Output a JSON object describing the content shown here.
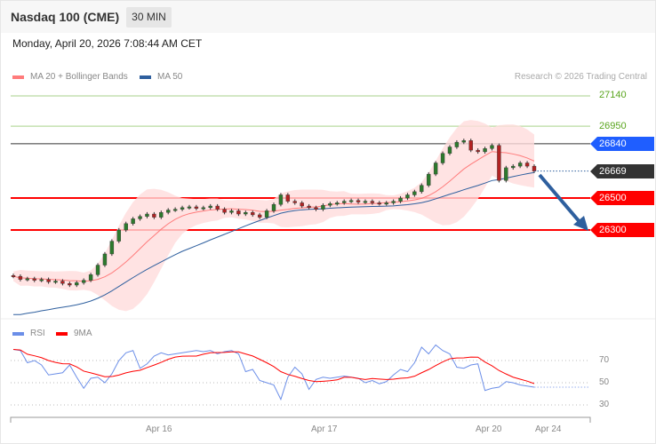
{
  "header": {
    "title": "Nasdaq 100 (CME)",
    "timeframe": "30 MIN",
    "datetime": "Monday, April 20, 2026 7:08:44 AM CET"
  },
  "legend": {
    "ma20": "MA 20 + Bollinger Bands",
    "ma50": "MA 50",
    "rsi": "RSI",
    "ma9": "9MA",
    "credit": "Research © 2026 Trading Central"
  },
  "colors": {
    "ma20": "#ff7b7b",
    "ma50": "#2e5f9e",
    "rsi": "#6b8ee8",
    "ma9": "#ff0000",
    "resistance": "#7dbb3d",
    "support": "#ff0000",
    "pivot": "#1f5eff",
    "last": "#333333",
    "arrow": "#2e5f9e"
  },
  "levels": {
    "r2": "27140",
    "r1": "26950",
    "pivot": "26840",
    "last": "26669",
    "s1": "26500",
    "s2": "26300"
  },
  "rsi_axis": [
    "70",
    "50",
    "30"
  ],
  "x_axis": [
    "Apr 16",
    "Apr 17",
    "Apr 20",
    "Apr 24"
  ],
  "chart_data": {
    "type": "candlestick",
    "price_range": [
      25700,
      27200
    ],
    "closes": [
      26010,
      25990,
      25995,
      25985,
      25990,
      25975,
      25980,
      25965,
      25955,
      25970,
      25985,
      26020,
      26080,
      26150,
      26230,
      26300,
      26340,
      26370,
      26385,
      26400,
      26380,
      26410,
      26425,
      26430,
      26440,
      26445,
      26435,
      26440,
      26450,
      26430,
      26410,
      26420,
      26400,
      26410,
      26395,
      26380,
      26420,
      26460,
      26520,
      26480,
      26470,
      26450,
      26440,
      26430,
      26455,
      26465,
      26470,
      26480,
      26485,
      26475,
      26480,
      26470,
      26465,
      26470,
      26480,
      26500,
      26520,
      26540,
      26580,
      26650,
      26720,
      26780,
      26820,
      26850,
      26860,
      26800,
      26790,
      26810,
      26830,
      26610,
      26690,
      26700,
      26720,
      26700,
      26669
    ],
    "rsi": [
      80,
      79,
      68,
      70,
      66,
      57,
      58,
      59,
      66,
      55,
      45,
      54,
      55,
      50,
      58,
      70,
      77,
      79,
      63,
      67,
      74,
      77,
      75,
      76,
      77,
      78,
      79,
      78,
      79,
      76,
      78,
      79,
      76,
      60,
      62,
      52,
      50,
      48,
      35,
      55,
      64,
      58,
      44,
      53,
      55,
      54,
      55,
      56,
      55,
      54,
      50,
      52,
      49,
      51,
      57,
      62,
      60,
      68,
      82,
      76,
      84,
      79,
      76,
      64,
      63,
      66,
      67,
      43,
      45,
      46,
      51,
      50,
      48,
      47,
      46
    ],
    "rsi_range": [
      20,
      85
    ],
    "forecast": {
      "from": "26669",
      "to": "26300",
      "direction": "down"
    }
  }
}
